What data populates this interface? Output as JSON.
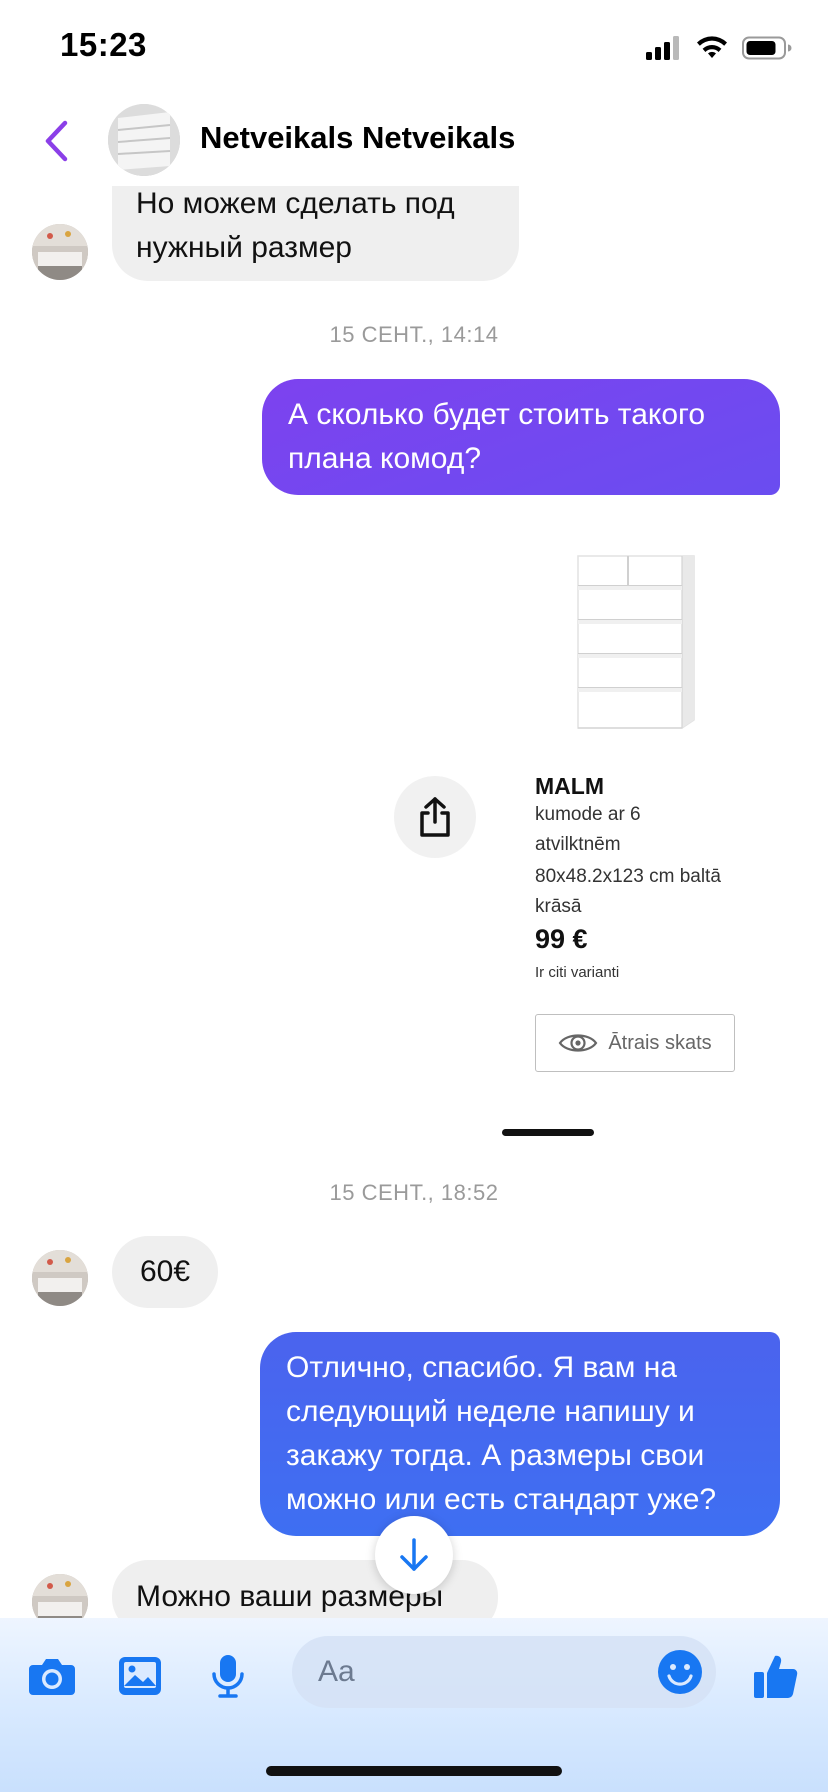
{
  "status_bar": {
    "time": "15:23"
  },
  "header": {
    "contact_name": "Netveikals Netveikals",
    "back_icon": "chevron-left-icon"
  },
  "messages": [
    {
      "side": "in",
      "text_lines": [
        "Но можем сделать под",
        "нужный размер"
      ]
    },
    {
      "type": "timestamp",
      "text": "15 СЕНТ., 14:14"
    },
    {
      "side": "out",
      "text_lines": [
        "А сколько будет стоить такого",
        "плана комод?"
      ]
    },
    {
      "type": "timestamp",
      "text": "15 СЕНТ., 18:52"
    },
    {
      "side": "in",
      "text_lines": [
        "60€"
      ]
    },
    {
      "side": "out",
      "text_lines": [
        "Отлично, спасибо. Я вам на",
        "следующий неделе напишу и",
        "закажу тогда. А размеры свои",
        "можно или есть стандарт уже?"
      ]
    },
    {
      "side": "in",
      "text_lines": [
        "Можно ваши размеры"
      ]
    }
  ],
  "product_card": {
    "name": "MALM",
    "description_lines": [
      "kumode ar 6",
      "atvilktnēm"
    ],
    "size_lines": [
      "80x48.2x123 cm baltā",
      "krāsā"
    ],
    "price": "99 €",
    "variants_note": "Ir citi varianti",
    "quick_view_label": "Ātrais skats"
  },
  "composer": {
    "placeholder": "Aa",
    "icons": [
      "camera-icon",
      "gallery-icon",
      "microphone-icon",
      "emoji-icon",
      "thumbs-up-icon"
    ]
  },
  "colors": {
    "accent_purple": "#7c3fe8",
    "bubble_out_gradient_top": "#7a45f0",
    "bubble_out_gradient_mid": "#4c67f0",
    "bubble_out_blue": "#3c6ff2",
    "bubble_in": "#efefef",
    "icon_blue": "#1877f2",
    "timestamp_gray": "#9a9a9a"
  }
}
